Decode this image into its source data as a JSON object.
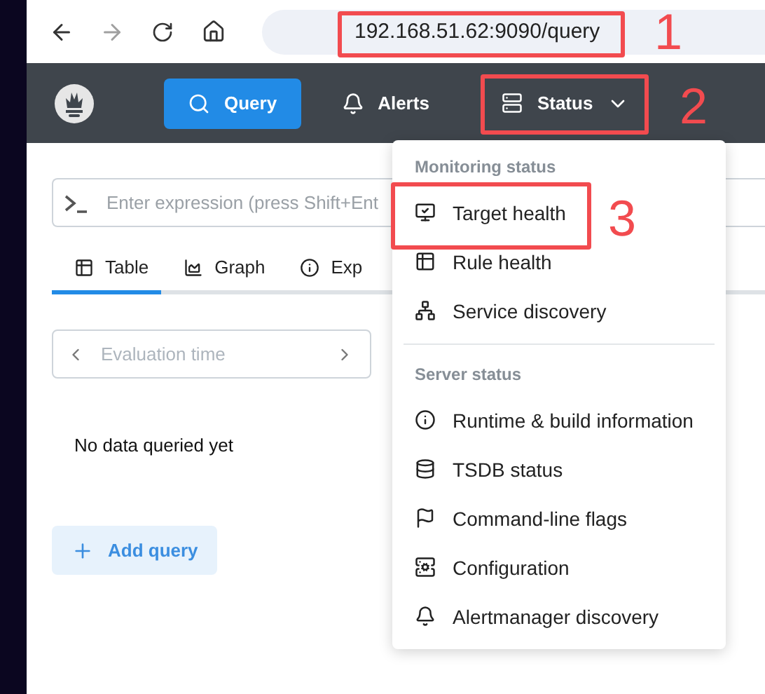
{
  "browser": {
    "url": "192.168.51.62:9090/query"
  },
  "nav": {
    "items": [
      {
        "label": "Query",
        "selected": true,
        "kind": "link"
      },
      {
        "label": "Alerts",
        "selected": false,
        "kind": "link"
      },
      {
        "label": "Status",
        "selected": false,
        "kind": "menu"
      }
    ]
  },
  "query": {
    "placeholder": "Enter expression (press Shift+Ent",
    "tabs": [
      {
        "label": "Table",
        "selected": true
      },
      {
        "label": "Graph",
        "selected": false
      },
      {
        "label": "Exp",
        "selected": false
      }
    ],
    "evaluation_time": {
      "placeholder": "Evaluation time"
    },
    "empty_message": "No data queried yet"
  },
  "add_query": "Add query",
  "status_menu": {
    "sections": [
      {
        "heading": "Monitoring status",
        "items": [
          "Target health",
          "Rule health",
          "Service discovery"
        ]
      },
      {
        "heading": "Server status",
        "items": [
          "Runtime & build information",
          "TSDB status",
          "Command-line flags",
          "Configuration",
          "Alertmanager discovery"
        ]
      }
    ]
  },
  "annotations": [
    "1",
    "2",
    "3"
  ]
}
